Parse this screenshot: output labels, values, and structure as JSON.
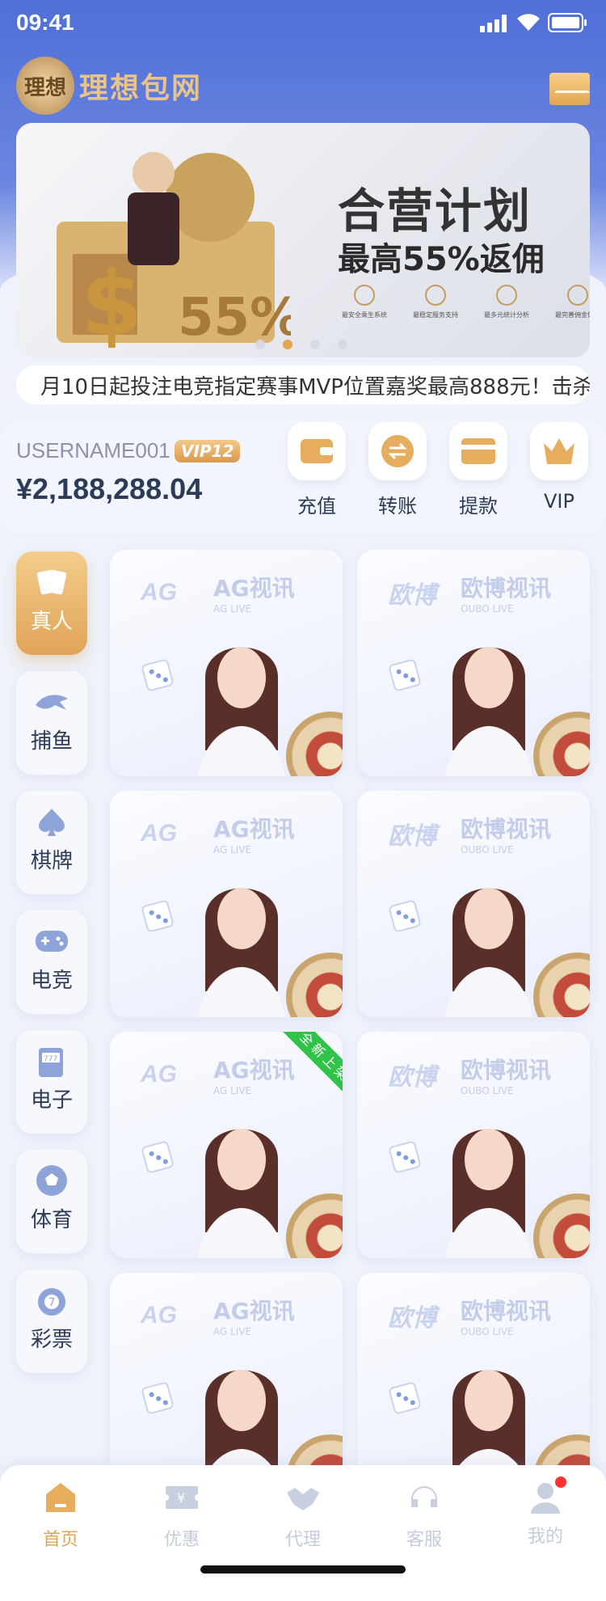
{
  "status": {
    "time": "09:41"
  },
  "brand": {
    "logo_glyph": "理想",
    "name": "理想包网"
  },
  "banner": {
    "title": "合营计划",
    "subtitle": "最高55%返佣",
    "features": [
      "最安全乘生系统",
      "最稳定服务支持",
      "最多元统计分析",
      "最完善佣金体系"
    ],
    "art_text": "55%",
    "active_dot": 1,
    "dot_count": 4
  },
  "notice": {
    "text": "​月10日起投注电竞指定赛事MVP位置嘉奖最高888元！击杀！"
  },
  "account": {
    "username": "USERNAME001",
    "vip_badge": "VIP12",
    "balance": "¥2,188,288.04"
  },
  "quick_actions": [
    "充值",
    "转账",
    "提款",
    "VIP"
  ],
  "categories": [
    "真人",
    "捕鱼",
    "棋牌",
    "电竞",
    "电子",
    "体育",
    "彩票"
  ],
  "cards": [
    {
      "logo": "AG",
      "name": "AG视讯",
      "en": "AG LIVE"
    },
    {
      "logo": "欧博",
      "name": "欧博视讯",
      "en": "OUBO LIVE"
    },
    {
      "logo": "AG",
      "name": "AG视讯",
      "en": "AG LIVE"
    },
    {
      "logo": "欧博",
      "name": "欧博视讯",
      "en": "OUBO LIVE"
    },
    {
      "logo": "AG",
      "name": "AG视讯",
      "en": "AG LIVE",
      "ribbon": "全新上架"
    },
    {
      "logo": "欧博",
      "name": "欧博视讯",
      "en": "OUBO LIVE"
    },
    {
      "logo": "AG",
      "name": "AG视讯",
      "en": "AG LIVE"
    },
    {
      "logo": "欧博",
      "name": "欧博视讯",
      "en": "OUBO LIVE"
    }
  ],
  "tabs": [
    "首页",
    "优惠",
    "代理",
    "客服",
    "我的"
  ],
  "colors": {
    "header": "#4f6fd8",
    "accent": "#e2a653",
    "text": "#2c3b57",
    "ribbon": "#31c24a"
  }
}
